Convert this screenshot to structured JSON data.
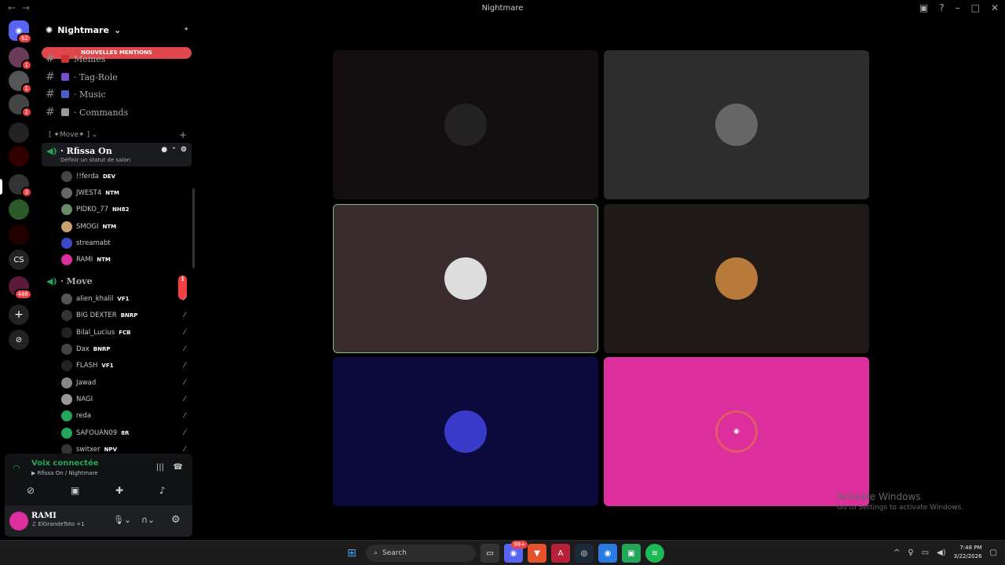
{
  "window": {
    "title": "Nightmare"
  },
  "servers": {
    "home_badge": "62",
    "items": [
      {
        "badge": "1"
      },
      {
        "badge": "1"
      },
      {
        "badge": "1"
      },
      {
        "badge": ""
      },
      {
        "badge": ""
      },
      {
        "badge": "3"
      },
      {
        "badge": ""
      },
      {
        "badge": ""
      },
      {
        "label": "CS"
      },
      {
        "badge": "486"
      }
    ]
  },
  "guild": {
    "name": "Nightmare"
  },
  "banner": {
    "text": "NOUVELLES MENTIONS"
  },
  "channels": [
    {
      "label": "Memes"
    },
    {
      "label": "· Tag-Role"
    },
    {
      "label": "· Music"
    },
    {
      "label": "· Commands"
    }
  ],
  "category": {
    "label": "[ ✦Move✦ ]"
  },
  "voice1": {
    "name": "· Rfissa On",
    "status": "Définir un statut de salon",
    "members": [
      {
        "name": "!!ferda",
        "tag": "DEV"
      },
      {
        "name": "JWEST4",
        "tag": "NTM"
      },
      {
        "name": "PIDKO_77",
        "tag": "NH82"
      },
      {
        "name": "SMOGI",
        "tag": "NTM"
      },
      {
        "name": "streamabt",
        "tag": ""
      },
      {
        "name": "RAMI",
        "tag": "NTM"
      }
    ]
  },
  "voice2": {
    "name": "· Move",
    "badge": "1",
    "members": [
      {
        "name": "alien_khalil",
        "tag": "VF1"
      },
      {
        "name": "BIG DEXTER",
        "tag": "BNRP"
      },
      {
        "name": "Bilal_Lucius",
        "tag": "FCB"
      },
      {
        "name": "Dax",
        "tag": "BNRP"
      },
      {
        "name": "FLASH",
        "tag": "VF1"
      },
      {
        "name": "Jawad",
        "tag": ""
      },
      {
        "name": "NAGI",
        "tag": ""
      },
      {
        "name": "reda",
        "tag": ""
      },
      {
        "name": "SAFOUAN09",
        "tag": "8R"
      },
      {
        "name": "switxer",
        "tag": "NPV"
      }
    ]
  },
  "voice_panel": {
    "status": "Voix connectée",
    "channel": "Rfissa On / Nightmare"
  },
  "user": {
    "name": "RAMI",
    "activity": "ElGrandeToto +1"
  },
  "watermark": {
    "title": "Activate Windows",
    "sub": "Go to Settings to activate Windows."
  },
  "taskbar": {
    "search": "Search",
    "discord_badge": "99+",
    "time": "7:48 PM",
    "date": "3/22/2026"
  },
  "colors": {
    "accent": "#23a55a",
    "mention": "#e0474b",
    "tile_pink": "#dc2e9c",
    "tile_navy": "#0b0a3c"
  }
}
